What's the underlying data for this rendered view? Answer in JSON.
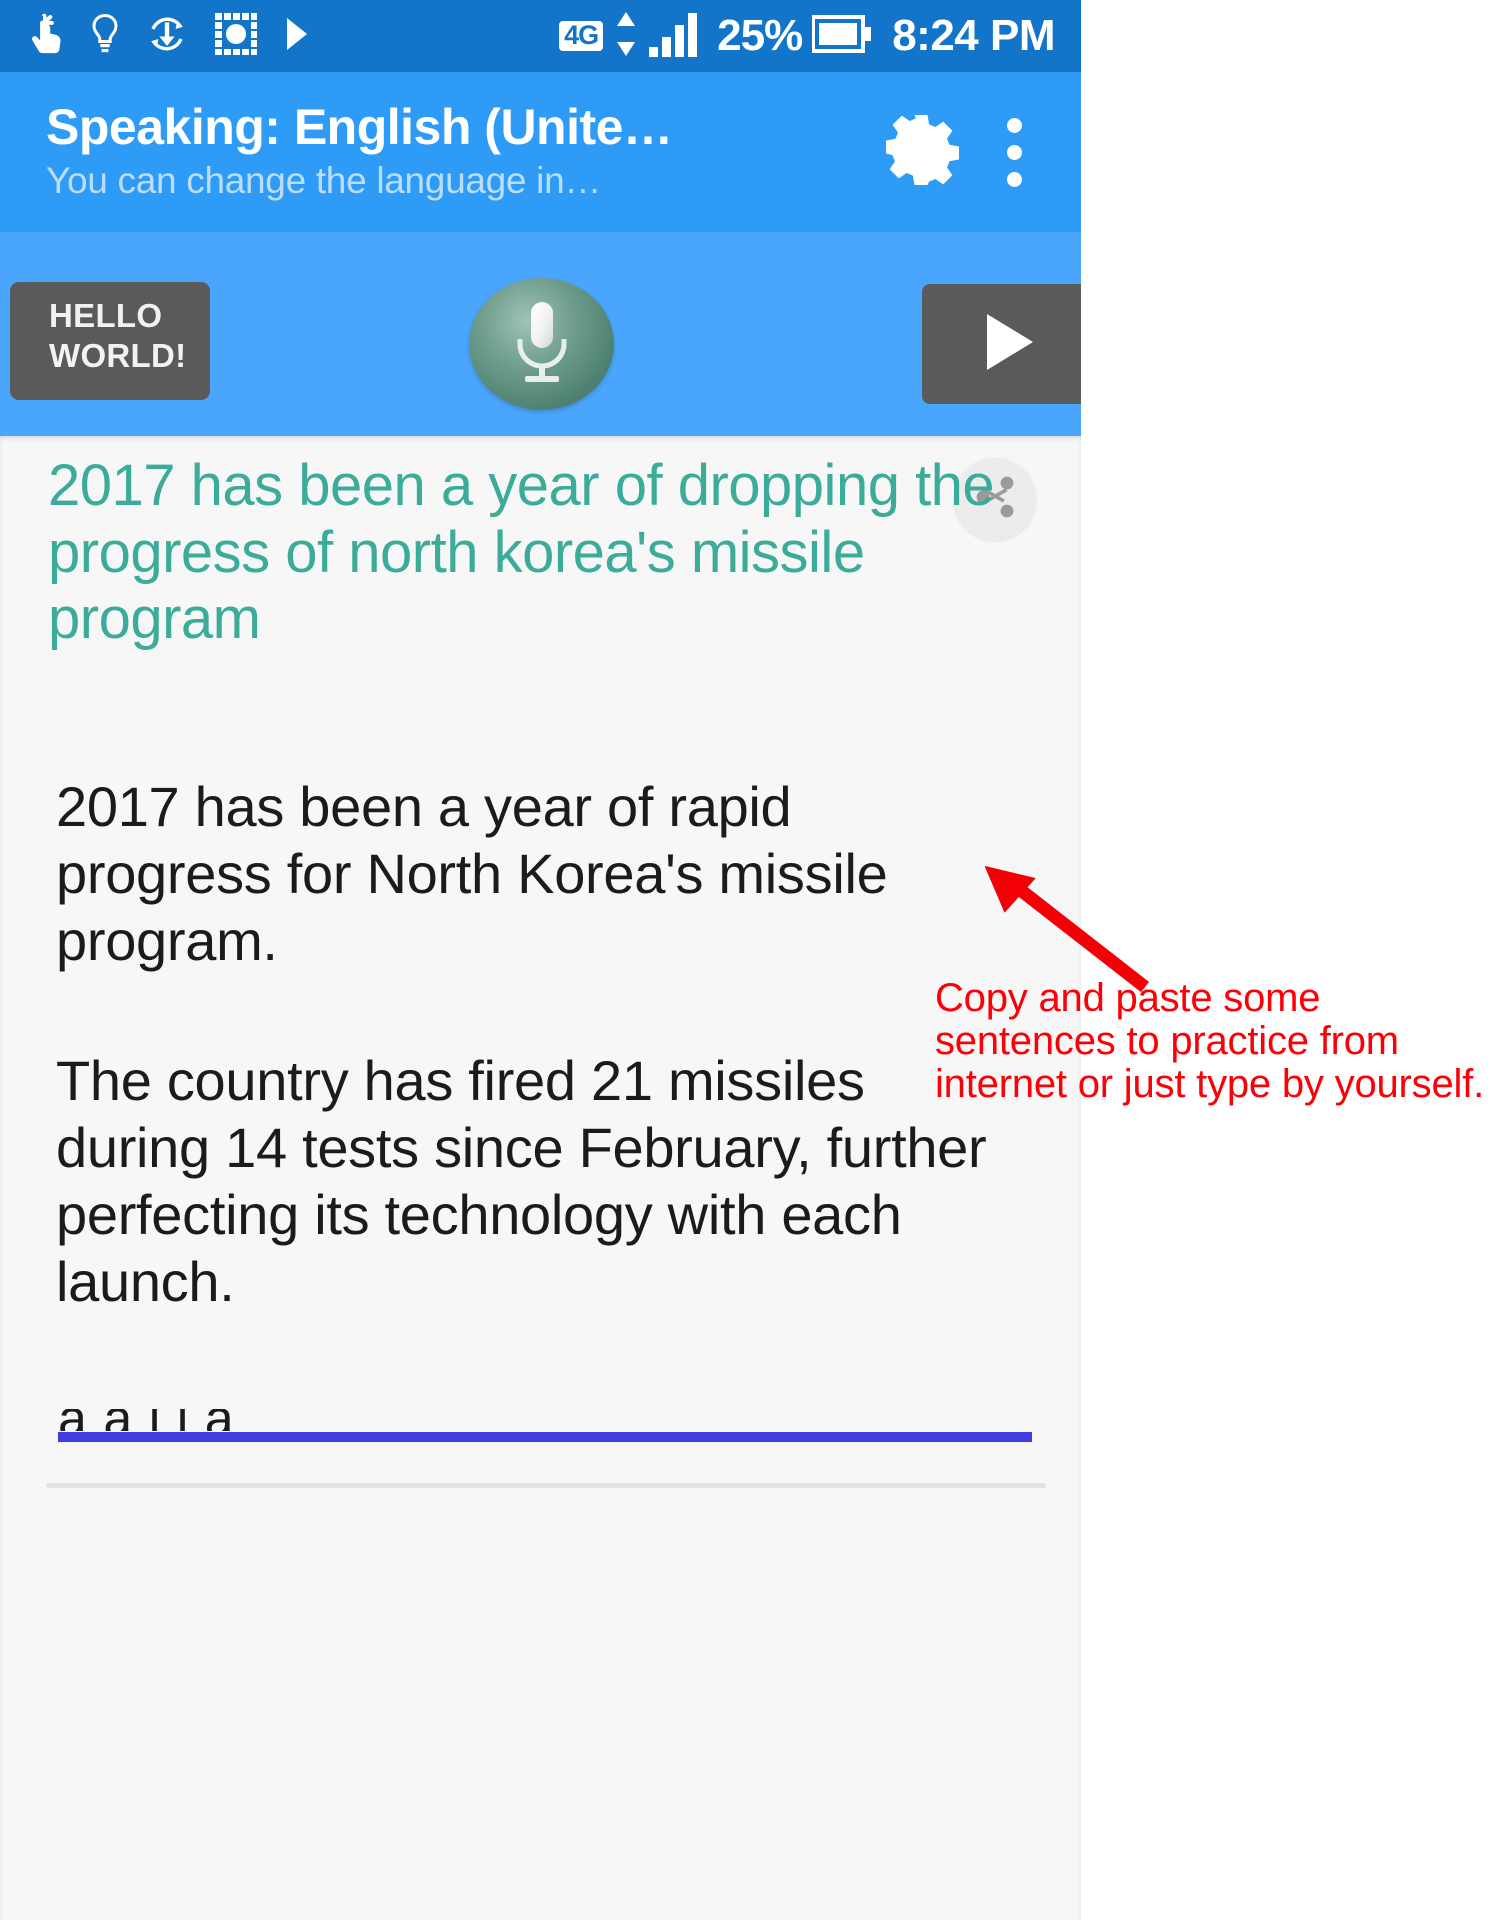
{
  "statusbar": {
    "icons": [
      {
        "name": "touch-pointer-icon"
      },
      {
        "name": "lightbulb-icon"
      },
      {
        "name": "download-sync-icon"
      },
      {
        "name": "screen-capture-icon"
      },
      {
        "name": "play-arrow-icon"
      }
    ],
    "network_type": "4G",
    "data_transfer_icon": "up-down-arrows-icon",
    "signal_icon": "signal-bars-icon",
    "battery_percent": "25%",
    "battery_icon": "battery-icon",
    "clock": "8:24 PM"
  },
  "appbar": {
    "title": "Speaking: English (Unite…",
    "subtitle": "You can change the language in…",
    "settings_icon": "gear-icon",
    "overflow_icon": "more-vertical-icon"
  },
  "controls": {
    "hello_button_label": "HELLO\nWORLD!",
    "mic_icon": "microphone-icon",
    "play_icon": "play-icon"
  },
  "content": {
    "share_icon": "share-icon",
    "headline": "2017 has been a year of dropping the progress of north korea's missile program",
    "paragraphs": [
      "2017 has been a year of rapid progress for North Korea's missile program.",
      "The country has fired 21 missiles during 14 tests since February, further perfecting its technology with each launch."
    ],
    "input_value": "a a l l a"
  },
  "annotation": {
    "text": "Copy and paste some sentences to practice from internet or just type by yourself.",
    "arrow_icon": "red-arrow-icon",
    "color": "#fb0007"
  },
  "colors": {
    "statusbar_bg": "#1275c9",
    "appbar_bg": "#2e9bf7",
    "controlbar_bg": "#4aa6fc",
    "content_bg": "#f7f7f7",
    "headline_color": "#3bab9a",
    "button_gray": "#5a5a5a",
    "mic_green": "#5d8f7f",
    "input_underline": "#3f3fe0"
  }
}
